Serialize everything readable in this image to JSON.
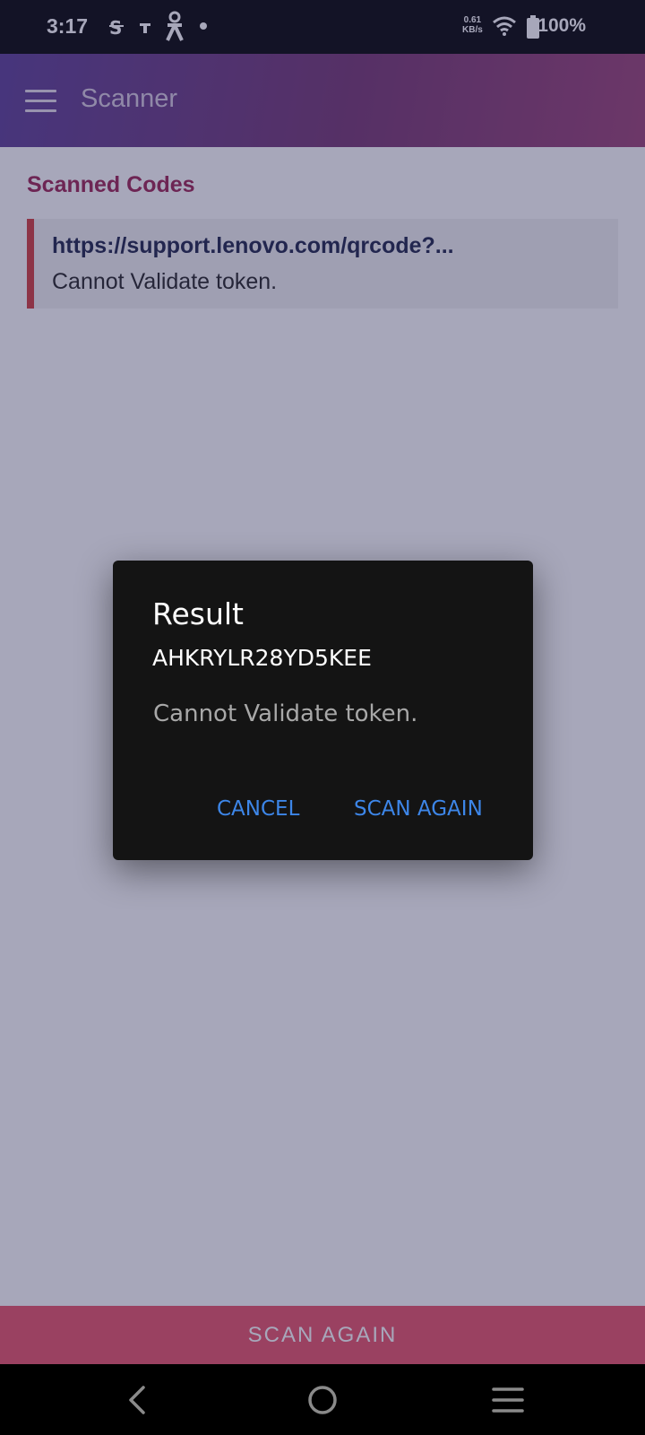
{
  "status_bar": {
    "time": "3:17",
    "speed_value": "0.61",
    "speed_unit": "KB/s",
    "battery": "100%",
    "icons": [
      "sim-icon",
      "usb-icon",
      "accessibility-icon",
      "dot-icon",
      "wifi-icon",
      "battery-icon"
    ]
  },
  "app_bar": {
    "title": "Scanner",
    "menu_icon": "menu-icon"
  },
  "main": {
    "section_title": "Scanned Codes",
    "codes": [
      {
        "url": "https://support.lenovo.com/qrcode?...",
        "message": "Cannot Validate token."
      }
    ]
  },
  "dialog": {
    "title": "Result",
    "code": "AHKRYLR28YD5KEE",
    "message": "Cannot Validate token.",
    "cancel_label": "CANCEL",
    "scan_again_label": "SCAN AGAIN"
  },
  "bottom_button": {
    "label": "SCAN AGAIN"
  },
  "nav_bar": {
    "icons": [
      "back-icon",
      "home-icon",
      "recents-icon"
    ]
  },
  "colors": {
    "accent": "#9b1f50",
    "error_bar": "#d33a3a",
    "button": "#e85066",
    "dialog_button": "#3d86e8"
  }
}
